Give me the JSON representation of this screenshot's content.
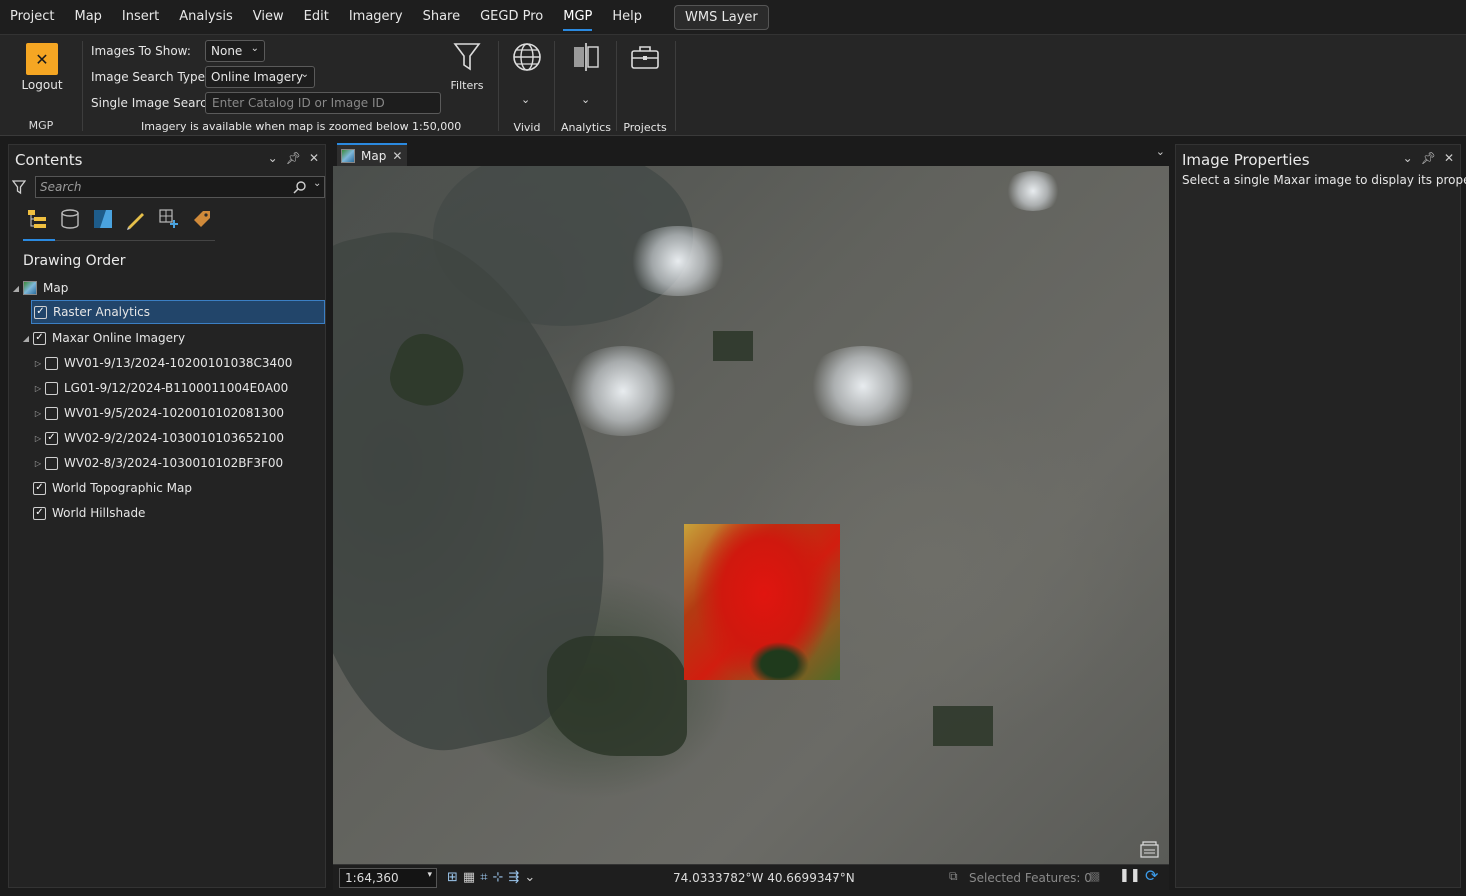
{
  "menubar": {
    "items": [
      "Project",
      "Map",
      "Insert",
      "Analysis",
      "View",
      "Edit",
      "Imagery",
      "Share",
      "GEGD Pro",
      "MGP",
      "Help"
    ],
    "active": "MGP",
    "wms_button": "WMS Layer"
  },
  "ribbon": {
    "logout_label": "Logout",
    "mgp_group_label": "MGP",
    "images_to_show_label": "Images To Show:",
    "images_to_show_value": "None",
    "image_search_type_label": "Image Search Type:",
    "image_search_type_value": "Online Imagery",
    "single_image_search_label": "Single Image Search:",
    "single_image_search_placeholder": "Enter Catalog ID or Image ID",
    "imagery_note": "Imagery is available when map is zoomed below 1:50,000",
    "filters_label": "Filters",
    "vivid_label": "Vivid",
    "analytics_label": "Analytics",
    "projects_label": "Projects"
  },
  "contents": {
    "title": "Contents",
    "search_placeholder": "Search",
    "drawing_order": "Drawing Order",
    "tree": [
      {
        "label": "Map",
        "level": 0,
        "checked": null,
        "expanded": true
      },
      {
        "label": "Raster Analytics",
        "level": 1,
        "checked": true,
        "selected": true
      },
      {
        "label": "Maxar Online Imagery",
        "level": 1,
        "checked": true,
        "expanded": true
      },
      {
        "label": "WV01-9/13/2024-10200101038C3400",
        "level": 2,
        "checked": false
      },
      {
        "label": "LG01-9/12/2024-B1100011004E0A00",
        "level": 2,
        "checked": false
      },
      {
        "label": "WV01-9/5/2024-1020010102081300",
        "level": 2,
        "checked": false
      },
      {
        "label": "WV02-9/2/2024-1030010103652100",
        "level": 2,
        "checked": true
      },
      {
        "label": "WV02-8/3/2024-1030010102BF3F00",
        "level": 2,
        "checked": false
      },
      {
        "label": "World Topographic Map",
        "level": 1,
        "checked": true
      },
      {
        "label": "World Hillshade",
        "level": 1,
        "checked": true
      }
    ]
  },
  "map": {
    "tab_label": "Map",
    "scale": "1:64,360",
    "coordinates": "74.0333782°W 40.6699347°N",
    "selected_features": "Selected Features: 0"
  },
  "image_properties": {
    "title": "Image Properties",
    "description": "Select a single Maxar image to display its properties."
  },
  "colors": {
    "accent": "#2b8ae0",
    "logout_icon": "#f5a623",
    "selection_bg": "#22456a"
  }
}
